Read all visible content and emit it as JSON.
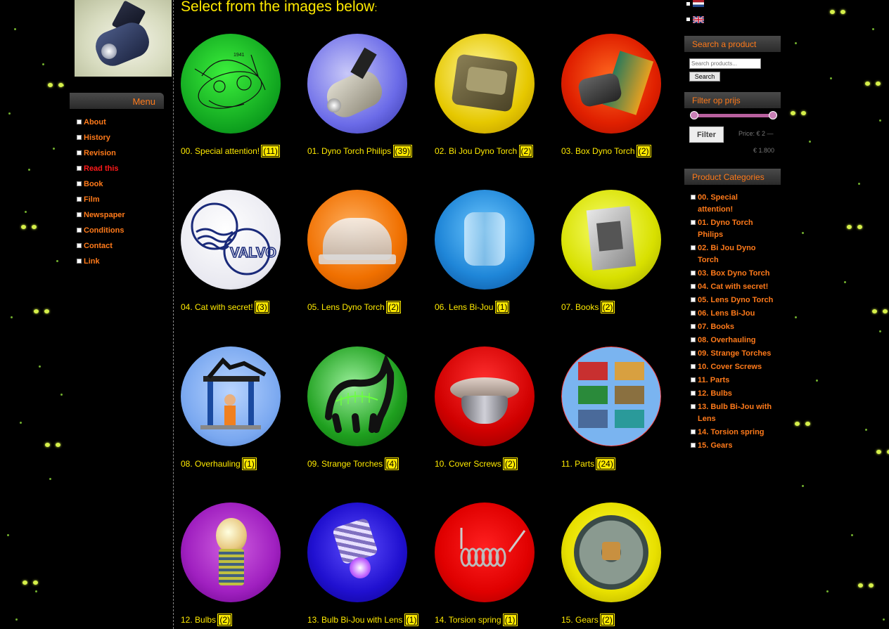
{
  "header": {
    "image_alt": ""
  },
  "menu": {
    "title": "Menu",
    "items": [
      {
        "label": "About"
      },
      {
        "label": "History"
      },
      {
        "label": "Revision"
      },
      {
        "label": "Read this",
        "active": true
      },
      {
        "label": "Book"
      },
      {
        "label": "Film"
      },
      {
        "label": "Newspaper"
      },
      {
        "label": "Conditions"
      },
      {
        "label": "Contact"
      },
      {
        "label": "Link"
      }
    ]
  },
  "main": {
    "title": "Select from the images below",
    "title_colon": ":",
    "categories": [
      {
        "name": "00. Special attention!",
        "count": "(11)",
        "image": "green-sketch"
      },
      {
        "name": "01. Dyno Torch Philips",
        "count": "(39)",
        "image": "blue-torch"
      },
      {
        "name": "02. Bi Jou Dyno Torch",
        "count": "(2)",
        "image": "yellow-torch"
      },
      {
        "name": "03. Box Dyno Torch",
        "count": "(2)",
        "image": "red-box"
      },
      {
        "name": "04. Cat with secret!",
        "count": "(3)",
        "image": "valvo-logo"
      },
      {
        "name": "05. Lens Dyno Torch",
        "count": "(2)",
        "image": "orange-lens"
      },
      {
        "name": "06. Lens Bi-Jou",
        "count": "(1)",
        "image": "blue-lens"
      },
      {
        "name": "07. Books",
        "count": "(2)",
        "image": "yellow-book"
      },
      {
        "name": "08. Overhauling",
        "count": "(1)",
        "image": "overhaul-cartoon"
      },
      {
        "name": "09. Strange Torches",
        "count": "(4)",
        "image": "green-cat"
      },
      {
        "name": "10. Cover Screws",
        "count": "(2)",
        "image": "red-screw"
      },
      {
        "name": "11. Parts",
        "count": "(24)",
        "image": "parts-collage"
      },
      {
        "name": "12. Bulbs",
        "count": "(2)",
        "image": "purple-bulb"
      },
      {
        "name": "13. Bulb Bi-Jou with Lens",
        "count": "(1)",
        "image": "blue-bulb"
      },
      {
        "name": "14. Torsion spring",
        "count": "(1)",
        "image": "red-spring"
      },
      {
        "name": "15. Gears",
        "count": "(2)",
        "image": "yellow-gear"
      }
    ]
  },
  "sidebar": {
    "search": {
      "title": "Search a product",
      "placeholder": "Search products...",
      "button_label": "Search"
    },
    "price_filter": {
      "title": "Filter op prijs",
      "button_label": "Filter",
      "price_text": "Price: € 2 —",
      "price_max_text": "€ 1.800",
      "range": [
        0,
        1
      ]
    },
    "categories": {
      "title": "Product Categories",
      "items": [
        "00. Special attention!",
        "01. Dyno Torch Philips",
        "02. Bi Jou Dyno Torch",
        "03. Box Dyno Torch",
        "04. Cat with secret!",
        "05. Lens Dyno Torch",
        "06. Lens Bi-Jou",
        "07. Books",
        "08. Overhauling",
        "09. Strange Torches",
        "10. Cover Screws",
        "11. Parts",
        "12. Bulbs",
        "13. Bulb Bi-Jou with Lens",
        "14. Torsion spring",
        "15. Gears"
      ]
    }
  },
  "colors": {
    "accent": "#ff7a1a",
    "highlight": "#ffea00",
    "active_menu": "#ff1a1a",
    "background": "#000000"
  }
}
